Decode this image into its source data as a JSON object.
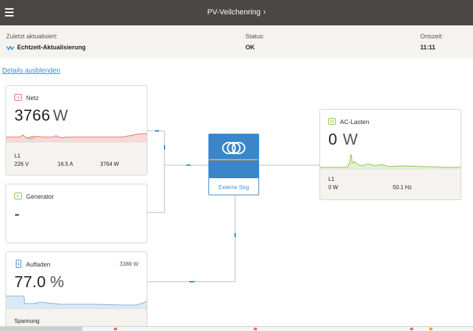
{
  "header": {
    "title": "PV-Veilchenring",
    "chevron": "›"
  },
  "info": {
    "updated_label": "Zuletzt aktualisiert:",
    "updated_value": "Echtzeit-Aktualisierung",
    "status_label": "Status:",
    "status_value": "OK",
    "time_label": "Ortszeit:",
    "time_value": "11:11"
  },
  "details_link": "Details ausblenden",
  "netz": {
    "title": "Netz",
    "power_value": "3766",
    "power_unit": "W",
    "phase": "L1",
    "voltage": "226 V",
    "current": "16.5 A",
    "phase_power": "3764 W"
  },
  "generator": {
    "title": "Generator",
    "value": "-"
  },
  "battery": {
    "title": "Aufladen",
    "power": "3388 W",
    "soc_value": "77.0",
    "soc_unit": "%",
    "footer_label": "Spannung"
  },
  "inverter": {
    "mode": "Externe Strg"
  },
  "ac_loads": {
    "title": "AC-Lasten",
    "power_value": "0",
    "power_unit": "W",
    "phase": "L1",
    "phase_power": "0 W",
    "frequency": "50.1 Hz"
  },
  "colors": {
    "topbar": "#4a4745",
    "accent_blue": "#3b8bd6",
    "grid_red": "#e56b6b",
    "green": "#8bc34a",
    "inverter_orange": "#f0a21e"
  }
}
